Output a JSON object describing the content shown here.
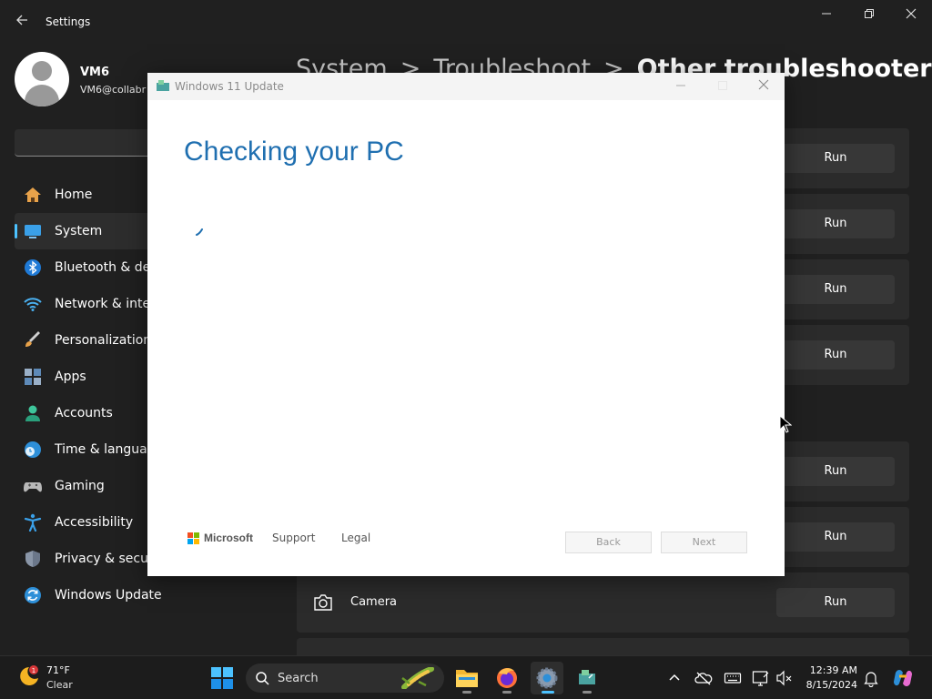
{
  "window": {
    "app_title": "Settings",
    "back_icon": "arrow-left-icon",
    "minimize_icon": "minimize-icon",
    "restore_icon": "restore-icon",
    "close_icon": "close-icon"
  },
  "profile": {
    "name": "VM6",
    "email": "VM6@collabr"
  },
  "search": {
    "placeholder": ""
  },
  "sidebar": {
    "items": [
      {
        "label": "Home",
        "icon": "home-icon"
      },
      {
        "label": "System",
        "icon": "system-icon",
        "active": true
      },
      {
        "label": "Bluetooth & dev",
        "icon": "bluetooth-icon"
      },
      {
        "label": "Network & inter",
        "icon": "wifi-icon"
      },
      {
        "label": "Personalization",
        "icon": "brush-icon"
      },
      {
        "label": "Apps",
        "icon": "apps-icon"
      },
      {
        "label": "Accounts",
        "icon": "accounts-icon"
      },
      {
        "label": "Time & language",
        "icon": "globe-clock-icon"
      },
      {
        "label": "Gaming",
        "icon": "gamepad-icon"
      },
      {
        "label": "Accessibility",
        "icon": "accessibility-icon"
      },
      {
        "label": "Privacy & securit",
        "icon": "shield-icon"
      },
      {
        "label": "Windows Update",
        "icon": "windows-update-icon"
      }
    ]
  },
  "breadcrumb": {
    "part1": "System",
    "part2": "Troubleshoot",
    "part3": "Other troubleshooters",
    "separator": ">"
  },
  "troubleshooters": {
    "run_label": "Run",
    "camera_label": "Camera"
  },
  "dialog": {
    "title": "Windows 11 Update",
    "heading": "Checking your PC",
    "brand": "Microsoft",
    "support_label": "Support",
    "legal_label": "Legal",
    "back_label": "Back",
    "next_label": "Next",
    "accent_color": "#1f6fb0"
  },
  "taskbar": {
    "temperature": "71°F",
    "condition": "Clear",
    "weather_badge": "1",
    "search_label": "Search",
    "time": "12:39 AM",
    "date": "8/15/2024",
    "accent_color": "#4cc2ff"
  }
}
